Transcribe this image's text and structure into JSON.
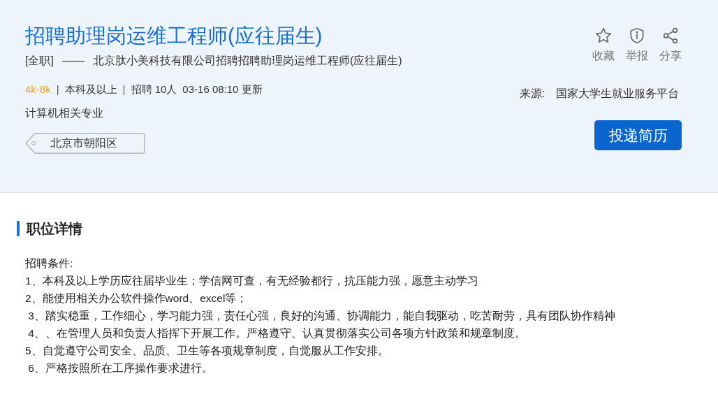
{
  "job": {
    "title": "招聘助理岗运维工程师(应往届生)",
    "type": "[全职]",
    "separator": "——",
    "company_line": "北京肽小美科技有限公司招聘招聘助理岗运维工程师(应往届生)",
    "salary": "4k-8k",
    "divider": "|",
    "education": "本科及以上",
    "headcount": "招聘 10人",
    "updated": "03-16 08:10 更新",
    "major": "计算机相关专业",
    "location": "北京市朝阳区"
  },
  "actions": [
    {
      "kind": "star",
      "label": "收藏"
    },
    {
      "kind": "report",
      "label": "举报"
    },
    {
      "kind": "share",
      "label": "分享"
    }
  ],
  "source": {
    "label": "来源:",
    "value": "国家大学生就业服务平台"
  },
  "apply_button": "投递简历",
  "details": {
    "heading": "职位详情",
    "lines": [
      "招聘条件:",
      "1、本科及以上学历应往届毕业生；学信网可查，有无经验都行，抗压能力强，愿意主动学习",
      "2、能使用相关办公软件操作word、excel等；",
      " 3、踏实稳重，工作细心，学习能力强，责任心强，良好的沟通、协调能力，能自我驱动，吃苦耐劳，具有团队协作精神",
      " 4、、在管理人员和负责人指挥下开展工作。严格遵守、认真贯彻落实公司各项方针政策和规章制度。",
      "5、自觉遵守公司安全、品质、卫生等各项规章制度，自觉服从工作安排。",
      " 6、严格按照所在工序操作要求进行。"
    ]
  }
}
